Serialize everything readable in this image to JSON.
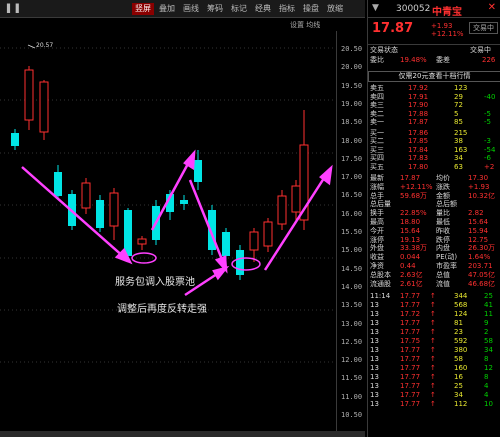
{
  "toolbar": {
    "items": [
      "竖屏",
      "叠加",
      "画线",
      "筹码",
      "标记",
      "经典",
      "指标",
      "操盘",
      "放缩",
      "统计"
    ],
    "active": "竖屏",
    "settings": "设置 均线"
  },
  "peak_label": "20.57",
  "annotations": {
    "a1": "服务包调入股票池",
    "a2": "调整后再度反转走强"
  },
  "yaxis": [
    "20.50",
    "20.00",
    "19.50",
    "19.00",
    "18.50",
    "18.00",
    "17.50",
    "17.00",
    "16.50",
    "16.00",
    "15.50",
    "15.00",
    "14.50",
    "14.00",
    "13.50",
    "13.00",
    "12.50",
    "12.00",
    "11.50",
    "11.00",
    "10.50"
  ],
  "colors": {
    "up": "#ff3030",
    "down": "#00e5e5",
    "arrow": "#ff40ff"
  },
  "quote": {
    "code": "300052",
    "name": "中青宝",
    "price": "17.87",
    "chg": "+1.93",
    "pct": "+12.11%",
    "close_icon": "close-icon",
    "btn": "交易中"
  },
  "header_rows": [
    {
      "l": "交易状态",
      "v": "",
      "r": "交易中"
    },
    {
      "l": "委比",
      "v": "19.48%",
      "r": "委差",
      "rv": "226"
    }
  ],
  "banner": "仅需20元查看十档行情",
  "asks": [
    {
      "l": "卖五",
      "p": "17.92",
      "v": "123",
      "d": ""
    },
    {
      "l": "卖四",
      "p": "17.91",
      "v": "29",
      "d": "-40"
    },
    {
      "l": "卖三",
      "p": "17.90",
      "v": "72",
      "d": ""
    },
    {
      "l": "卖二",
      "p": "17.88",
      "v": "5",
      "d": "-5"
    },
    {
      "l": "卖一",
      "p": "17.87",
      "v": "85",
      "d": "-5"
    }
  ],
  "bids": [
    {
      "l": "买一",
      "p": "17.86",
      "v": "215",
      "d": ""
    },
    {
      "l": "买二",
      "p": "17.85",
      "v": "38",
      "d": "-3"
    },
    {
      "l": "买三",
      "p": "17.84",
      "v": "163",
      "d": "-54"
    },
    {
      "l": "买四",
      "p": "17.83",
      "v": "34",
      "d": "-6"
    },
    {
      "l": "买五",
      "p": "17.80",
      "v": "63",
      "d": "+2"
    }
  ],
  "stats": [
    {
      "l1": "最新",
      "v1": "17.87",
      "l2": "均价",
      "v2": "17.30"
    },
    {
      "l1": "涨幅",
      "v1": "+12.11%",
      "l2": "涨跌",
      "v2": "+1.93"
    },
    {
      "l1": "总手",
      "v1": "59.68万",
      "l2": "金额",
      "v2": "10.32亿"
    },
    {
      "l1": "总后量",
      "v1": "",
      "l2": "总后额",
      "v2": ""
    },
    {
      "l1": "换手",
      "v1": "22.85%",
      "l2": "量比",
      "v2": "2.82"
    },
    {
      "l1": "最高",
      "v1": "18.80",
      "l2": "最低",
      "v2": "15.64"
    },
    {
      "l1": "今开",
      "v1": "15.64",
      "l2": "昨收",
      "v2": "15.94"
    },
    {
      "l1": "涨停",
      "v1": "19.13",
      "l2": "跌停",
      "v2": "12.75"
    },
    {
      "l1": "外盘",
      "v1": "33.38万",
      "l2": "内盘",
      "v2": "26.30万"
    },
    {
      "l1": "收益",
      "v1": "0.044",
      "l2": "PE(动)",
      "v2": "1.64%"
    },
    {
      "l1": "净资",
      "v1": "0.44",
      "l2": "市盈率",
      "v2": "203.71"
    },
    {
      "l1": "总股本",
      "v1": "2.63亿",
      "l2": "总值",
      "v2": "47.05亿"
    },
    {
      "l1": "流通股",
      "v1": "2.61亿",
      "l2": "流值",
      "v2": "46.68亿"
    }
  ],
  "ticks": [
    {
      "t": "11:14",
      "p": "17.77",
      "v": "344",
      "n": "25"
    },
    {
      "t": "13",
      "p": "17.77",
      "v": "568",
      "n": "41"
    },
    {
      "t": "13",
      "p": "17.72",
      "v": "124",
      "n": "11"
    },
    {
      "t": "13",
      "p": "17.77",
      "v": "81",
      "n": "9"
    },
    {
      "t": "13",
      "p": "17.77",
      "v": "23",
      "n": "2"
    },
    {
      "t": "13",
      "p": "17.75",
      "v": "592",
      "n": "58"
    },
    {
      "t": "13",
      "p": "17.77",
      "v": "380",
      "n": "34"
    },
    {
      "t": "13",
      "p": "17.77",
      "v": "58",
      "n": "8"
    },
    {
      "t": "13",
      "p": "17.77",
      "v": "160",
      "n": "12"
    },
    {
      "t": "13",
      "p": "17.77",
      "v": "16",
      "n": "8"
    },
    {
      "t": "13",
      "p": "17.77",
      "v": "25",
      "n": "4"
    },
    {
      "t": "13",
      "p": "17.77",
      "v": "34",
      "n": "4"
    },
    {
      "t": "13",
      "p": "17.77",
      "v": "112",
      "n": "10"
    }
  ]
}
